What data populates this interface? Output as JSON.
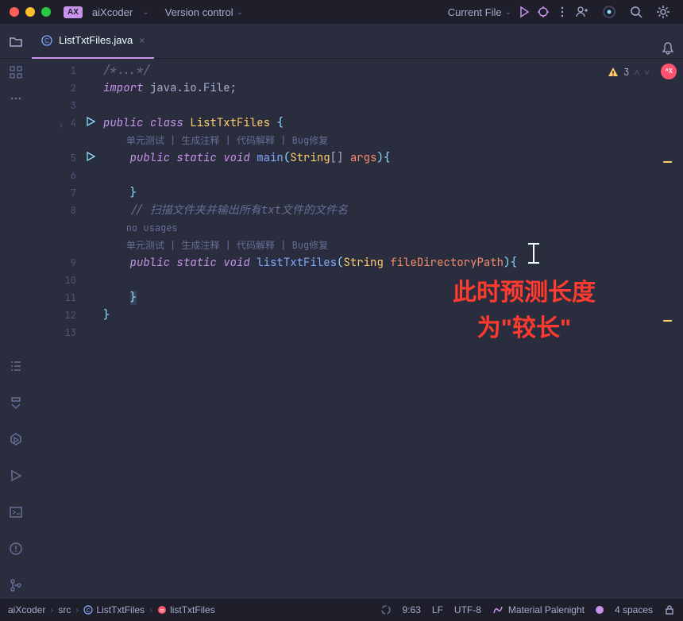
{
  "colors": {
    "bg": "#292d3e",
    "titlebar": "#1e1f2b",
    "accent": "#c792ea",
    "keyword": "#c792ea",
    "class": "#ffcb6b",
    "method": "#82aaff",
    "comment": "#676e95",
    "punct": "#89ddff",
    "annotation": "#ff3b30"
  },
  "titlebar": {
    "app_badge": "AX",
    "app_name": "aiXcoder",
    "vcs": "Version control",
    "config": "Current File"
  },
  "tab": {
    "file_name": "ListTxtFiles.java"
  },
  "inspection": {
    "warning_count": "3"
  },
  "ax_badge": "^X",
  "code": {
    "line1": "/*...*/",
    "line2_import": "import",
    "line2_pkg": " java.io.File;",
    "line4_pub": "public ",
    "line4_class": "class ",
    "line4_name": "ListTxtFiles",
    "line4_brace": " {",
    "hints1": "单元测试 | 生成注释 | 代码解释 | Bug修复",
    "line5_pub": "public ",
    "line5_static": "static ",
    "line5_void": "void ",
    "line5_main": "main",
    "line5_paren_open": "(",
    "line5_type": "String",
    "line5_arr": "[] ",
    "line5_arg": "args",
    "line5_close": "){",
    "line7_brace": "}",
    "line8_cmt": "// 扫描文件夹并输出所有txt文件的文件名",
    "no_usages": "no usages",
    "hints2": "单元测试 | 生成注释 | 代码解释 | Bug修复",
    "line9_pub": "public ",
    "line9_static": "static ",
    "line9_void": "void ",
    "line9_name": "listTxtFiles",
    "line9_paren": "(",
    "line9_type": "String",
    "line9_sp": " ",
    "line9_arg": "fileDirectoryPath",
    "line9_close": "){",
    "line11_brace": "}",
    "line12_brace": "}"
  },
  "lines": [
    "1",
    "2",
    "3",
    "4",
    "5",
    "6",
    "7",
    "8",
    "",
    "9",
    "10",
    "11",
    "12",
    "13"
  ],
  "annotation": {
    "l1": "此时预测长度",
    "l2": "为\"较长\""
  },
  "breadcrumb": {
    "root": "aiXcoder",
    "src": "src",
    "file": "ListTxtFiles",
    "method": "listTxtFiles"
  },
  "status": {
    "pos": "9:63",
    "line_sep": "LF",
    "encoding": "UTF-8",
    "theme": "Material Palenight",
    "indent": "4 spaces"
  }
}
